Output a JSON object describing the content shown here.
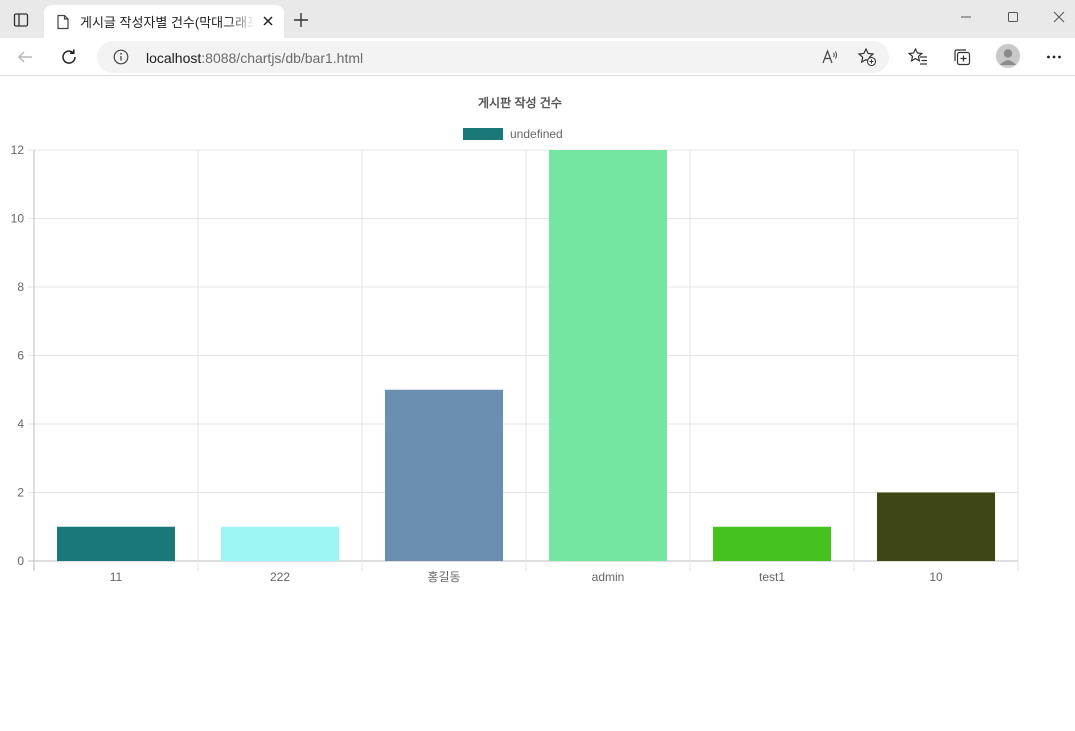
{
  "browser": {
    "tab_title": "게시글 작성자별 건수(막대그래프)",
    "url_host": "localhost",
    "url_rest": ":8088/chartjs/db/bar1.html",
    "icons": {
      "tab_actions": "tab-actions-icon",
      "page": "page-icon",
      "close": "close-icon",
      "new_tab": "plus-icon",
      "back": "back-arrow-icon",
      "refresh": "refresh-icon",
      "site_info": "info-icon",
      "read_aloud": "read-aloud-icon",
      "add_favorite": "star-plus-icon",
      "favorites": "favorites-icon",
      "collections": "collections-icon",
      "profile": "profile-avatar-icon",
      "menu": "more-icon"
    }
  },
  "chart_data": {
    "type": "bar",
    "title": "게시판 작성 건수",
    "categories": [
      "11",
      "222",
      "홍길동",
      "admin",
      "test1",
      "10"
    ],
    "values": [
      1,
      1,
      5,
      12,
      1,
      2
    ],
    "colors": [
      "#1a7878",
      "#9df5f4",
      "#6b8fb0",
      "#75e6a2",
      "#45c21d",
      "#3e4615"
    ],
    "legend": {
      "label": "undefined",
      "color": "#1a7878",
      "position": "top"
    },
    "y_ticks": [
      "0",
      "2",
      "4",
      "6",
      "8",
      "10",
      "12"
    ],
    "ylim": [
      0,
      12
    ],
    "grid": true
  }
}
